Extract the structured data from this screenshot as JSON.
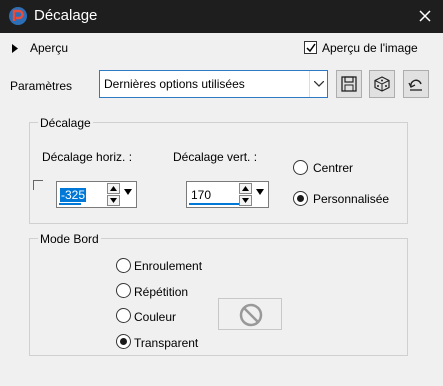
{
  "window": {
    "title": "Décalage"
  },
  "preview": {
    "toggle_label": "Aperçu",
    "image_preview_label": "Aperçu de l'image",
    "image_preview_checked": true
  },
  "params": {
    "label": "Paramètres",
    "preset_value": "Dernières options utilisées"
  },
  "offset_group": {
    "title": "Décalage",
    "horiz_label": "Décalage horiz. :",
    "horiz_value": "-325",
    "vert_label": "Décalage vert. :",
    "vert_value": "170",
    "center_label": "Centrer",
    "custom_label": "Personnalisée",
    "selected": "custom"
  },
  "edge_group": {
    "title": "Mode Bord",
    "options": [
      "Enroulement",
      "Répétition",
      "Couleur",
      "Transparent"
    ],
    "selected": "Transparent"
  },
  "colors": {
    "titlebar": "#1e1e1e",
    "accent": "#0078d7",
    "combo_border": "#2f78c4"
  },
  "icons": [
    "app-logo-icon",
    "close-icon",
    "triangle-right-icon",
    "checkmark-icon",
    "chevron-down-icon",
    "save-icon",
    "dice-icon",
    "reset-icon",
    "arrow-up-icon",
    "arrow-down-icon",
    "no-sign-icon"
  ]
}
